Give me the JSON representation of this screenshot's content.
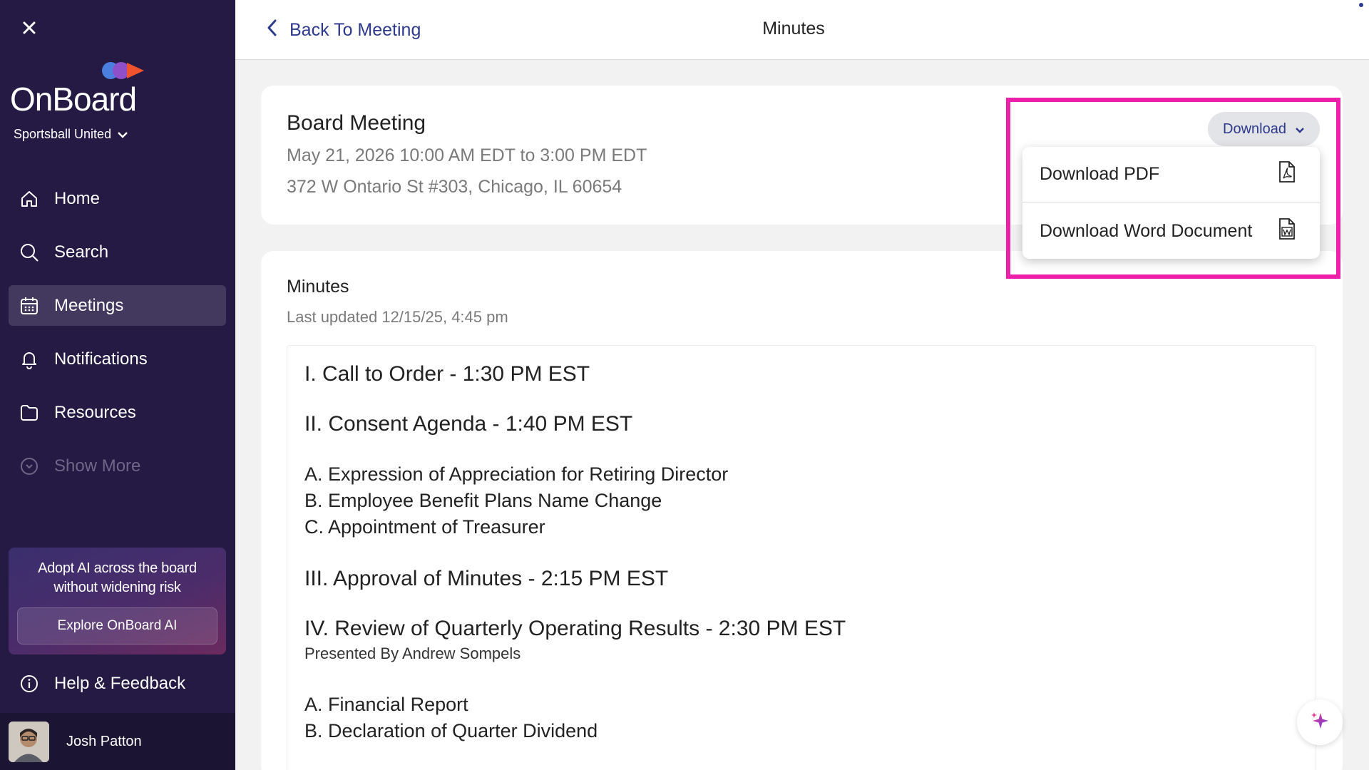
{
  "sidebar": {
    "brand": "OnBoard",
    "org": "Sportsball United",
    "nav": [
      {
        "label": "Home",
        "icon": "home-icon"
      },
      {
        "label": "Search",
        "icon": "search-icon"
      },
      {
        "label": "Meetings",
        "icon": "calendar-icon",
        "active": true
      },
      {
        "label": "Notifications",
        "icon": "bell-icon"
      },
      {
        "label": "Resources",
        "icon": "folder-icon"
      },
      {
        "label": "Show More",
        "icon": "chevron-circle-icon"
      }
    ],
    "promo": {
      "text": "Adopt AI across the board without widening risk",
      "button": "Explore OnBoard AI"
    },
    "help": "Help & Feedback",
    "user": "Josh Patton"
  },
  "topbar": {
    "back_label": "Back To Meeting",
    "title": "Minutes"
  },
  "meeting": {
    "title": "Board Meeting",
    "date": "May 21, 2026 10:00 AM EDT to 3:00 PM EDT",
    "location": "372 W Ontario St #303, Chicago, IL 60654",
    "download_label": "Download"
  },
  "download_menu": {
    "pdf": "Download PDF",
    "word": "Download Word Document"
  },
  "minutes": {
    "heading": "Minutes",
    "updated": "Last updated 12/15/25, 4:45 pm",
    "h1": "I. Call to Order - 1:30 PM EST",
    "h2": "II. Consent Agenda - 1:40 PM EST",
    "consent": [
      "A. Expression of Appreciation for Retiring Director",
      "B. Employee Benefit Plans Name Change",
      "C. Appointment of Treasurer"
    ],
    "h3": "III. Approval of Minutes - 2:15 PM EST",
    "h4": "IV. Review of Quarterly Operating Results - 2:30 PM EST",
    "h4_sub": "Presented By Andrew Sompels",
    "review": [
      "A. Financial Report",
      "B. Declaration of Quarter Dividend"
    ]
  },
  "colors": {
    "sidebar": "#241a43",
    "accent": "#2e3a8c",
    "highlight": "#ee1fa8"
  }
}
